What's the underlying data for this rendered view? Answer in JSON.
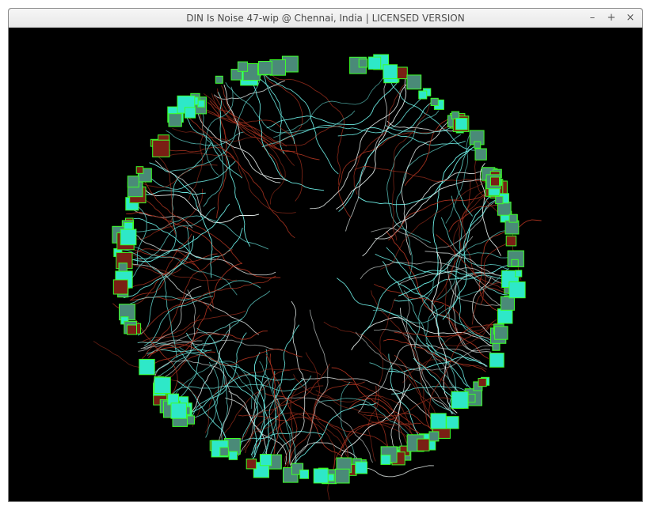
{
  "window": {
    "title": "DIN Is Noise 47-wip @ Chennai, India | LICENSED VERSION",
    "controls": {
      "minimize": "–",
      "maximize": "+",
      "close": "×"
    }
  },
  "canvas": {
    "background": "#000000",
    "colors": {
      "teal_fill": "#2ee8c8",
      "gray_fill": "#4a8a78",
      "red_fill": "#7a1f14",
      "square_stroke": "#3cff28",
      "trail_cyan": "#6ff2ea",
      "trail_red": "#a8321f",
      "trail_white": "#e8f0ee"
    }
  }
}
